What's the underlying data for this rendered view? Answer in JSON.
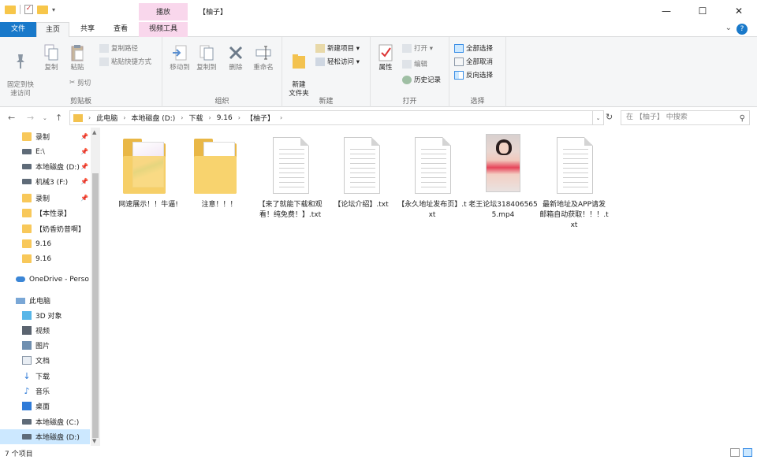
{
  "title_bar": {
    "context_tab": "播放",
    "window_title": "【柚子】",
    "controls": {
      "minimize": "—",
      "maximize": "☐",
      "close": "✕"
    }
  },
  "ribbon_tabs": {
    "file": "文件",
    "home": "主页",
    "share": "共享",
    "view": "查看",
    "video_tools": "视频工具"
  },
  "ribbon": {
    "clipboard": {
      "label": "剪贴板",
      "pin": "固定到快\n速访问",
      "copy": "复制",
      "paste": "粘贴",
      "copy_path": "复制路径",
      "paste_shortcut": "粘贴快捷方式",
      "cut": "剪切"
    },
    "organize": {
      "label": "组织",
      "move_to": "移动到",
      "copy_to": "复制到",
      "delete": "删除",
      "rename": "重命名"
    },
    "new": {
      "label": "新建",
      "new_folder": "新建\n文件夹",
      "new_item": "新建项目 ▾",
      "easy_access": "轻松访问 ▾"
    },
    "open": {
      "label": "打开",
      "properties": "属性",
      "open": "打开 ▾",
      "edit": "编辑",
      "history": "历史记录"
    },
    "select": {
      "label": "选择",
      "select_all": "全部选择",
      "select_none": "全部取消",
      "invert": "反向选择"
    }
  },
  "address": {
    "breadcrumb": [
      "此电脑",
      "本地磁盘 (D:)",
      "下载",
      "9.16",
      "【柚子】"
    ],
    "search_placeholder": "在 【柚子】 中搜索"
  },
  "nav_pane": {
    "items": [
      {
        "label": "录制",
        "icon": "folder-icon",
        "pinned": true
      },
      {
        "label": "E:\\",
        "icon": "drive-icon",
        "pinned": true
      },
      {
        "label": "本地磁盘 (D:)",
        "icon": "drive-icon",
        "pinned": true
      },
      {
        "label": "机械3 (F:)",
        "icon": "drive-icon",
        "pinned": true
      },
      {
        "label": "录制",
        "icon": "folder-icon",
        "pinned": true
      },
      {
        "label": "【本性录】",
        "icon": "folder-icon",
        "pinned": false
      },
      {
        "label": "【奶香奶昔啊】",
        "icon": "folder-icon",
        "pinned": false
      },
      {
        "label": "9.16",
        "icon": "folder-icon",
        "pinned": false
      },
      {
        "label": "9.16",
        "icon": "folder-icon",
        "pinned": false
      },
      {
        "label": "OneDrive - Perso",
        "icon": "cloud-icon",
        "pinned": false
      },
      {
        "label": "此电脑",
        "icon": "pc-icon",
        "pinned": false
      },
      {
        "label": "3D 对象",
        "icon": "cube-icon",
        "pinned": false
      },
      {
        "label": "视频",
        "icon": "video-icon",
        "pinned": false
      },
      {
        "label": "图片",
        "icon": "image-icon",
        "pinned": false
      },
      {
        "label": "文档",
        "icon": "document-icon",
        "pinned": false
      },
      {
        "label": "下载",
        "icon": "download-icon",
        "pinned": false
      },
      {
        "label": "音乐",
        "icon": "music-icon",
        "pinned": false
      },
      {
        "label": "桌面",
        "icon": "desktop-icon",
        "pinned": false
      },
      {
        "label": "本地磁盘 (C:)",
        "icon": "drive-icon",
        "pinned": false
      },
      {
        "label": "本地磁盘 (D:)",
        "icon": "drive-icon",
        "pinned": false,
        "selected": true
      }
    ]
  },
  "files": [
    {
      "name": "网速展示！！牛逼!",
      "type": "folder-images"
    },
    {
      "name": "注意！！！",
      "type": "folder"
    },
    {
      "name": "【来了就能下载和观看！纯免费！】.txt",
      "type": "txt"
    },
    {
      "name": "【论坛介绍】.txt",
      "type": "txt"
    },
    {
      "name": "【永久地址发布页】.txt",
      "type": "txt"
    },
    {
      "name": "老王论坛3184065655.mp4",
      "type": "video"
    },
    {
      "name": "最新地址及APP请发邮箱自动获取！！！.txt",
      "type": "txt"
    }
  ],
  "status": {
    "item_count": "7 个项目"
  },
  "colors": {
    "accent": "#1979ca",
    "context_tab": "#f9d7ec",
    "selection": "#cce8ff"
  }
}
